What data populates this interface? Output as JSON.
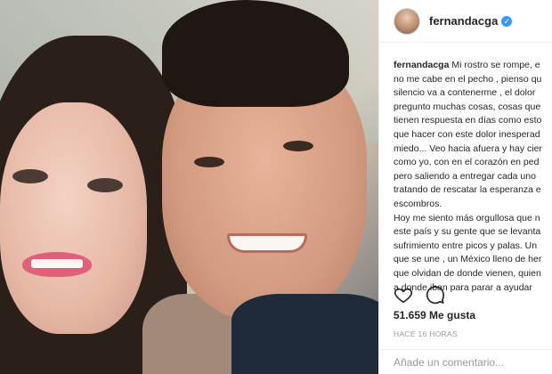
{
  "post": {
    "username": "fernandacga",
    "verified_mark": "✓",
    "caption_author": "fernandacga",
    "caption_lines": [
      " Mi rostro se rompe, e",
      "no me cabe en el pecho , pienso qu",
      "silencio va a contenerme , el dolor",
      "pregunto muchas cosas, cosas que",
      "tienen respuesta en días como esto",
      "que hacer con este dolor inesperad",
      "miedo... Veo hacia afuera y hay cier",
      "como yo, con en el corazón en ped",
      "pero saliendo a entregar cada uno",
      "tratando de rescatar la esperanza e",
      "escombros.",
      "Hoy me siento más orgullosa que n",
      "este país y su gente que se levanta",
      "sufrimiento entre picos y palas. Un",
      "que se une , un México lleno de her",
      "que olvidan de donde vienen, quien",
      "a donde iban para parar a ayudar"
    ],
    "likes": "51.659 Me gusta",
    "time": "HACE 16 HORAS",
    "comment_placeholder": "Añade un comentario..."
  },
  "icons": {
    "like": "heart-icon",
    "comment": "comment-icon",
    "verified": "verified-badge-icon"
  },
  "colors": {
    "verified_blue": "#3897f0",
    "text": "#262626",
    "muted": "#999999"
  }
}
